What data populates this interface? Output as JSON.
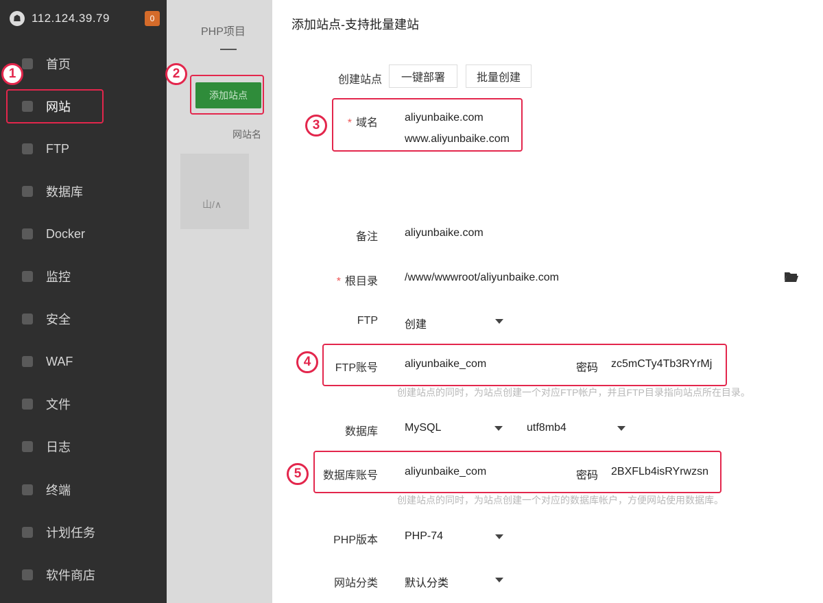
{
  "sidebar": {
    "server_ip": "112.124.39.79",
    "badge": "0",
    "items": [
      {
        "label": "首页",
        "icon": "home-icon"
      },
      {
        "label": "网站",
        "icon": "globe-icon"
      },
      {
        "label": "FTP",
        "icon": "ftp-icon"
      },
      {
        "label": "数据库",
        "icon": "database-icon"
      },
      {
        "label": "Docker",
        "icon": "docker-icon"
      },
      {
        "label": "监控",
        "icon": "monitor-icon"
      },
      {
        "label": "安全",
        "icon": "shield-icon"
      },
      {
        "label": "WAF",
        "icon": "waf-icon"
      },
      {
        "label": "文件",
        "icon": "folder-icon"
      },
      {
        "label": "日志",
        "icon": "log-icon"
      },
      {
        "label": "终端",
        "icon": "terminal-icon"
      },
      {
        "label": "计划任务",
        "icon": "clock-icon"
      },
      {
        "label": "软件商店",
        "icon": "store-icon"
      }
    ],
    "active_item": "网站"
  },
  "middle": {
    "tab_label": "PHP项目",
    "add_site_button": "添加站点",
    "text": "网站名",
    "block_text": "山/∧"
  },
  "dialog": {
    "title": "添加站点-支持批量建站",
    "create_label": "创建站点",
    "one_click_deploy": "一键部署",
    "batch_create": "批量创建",
    "domain_label": "域名",
    "domain_lines": [
      "aliyunbaike.com",
      "www.aliyunbaike.com"
    ],
    "remark_label": "备注",
    "remark_value": "aliyunbaike.com",
    "root_label": "根目录",
    "root_value": "/www/wwwroot/aliyunbaike.com",
    "ftp_label": "FTP",
    "ftp_value": "创建",
    "ftp_account_label": "FTP账号",
    "ftp_account_value": "aliyunbaike_com",
    "ftp_password_label": "密码",
    "ftp_password_value": "zc5mCTy4Tb3RYrMj",
    "ftp_hint": "创建站点的同时，为站点创建一个对应FTP帐户，并且FTP目录指向站点所在目录。",
    "db_label": "数据库",
    "db_value": "MySQL",
    "db_charset": "utf8mb4",
    "db_account_label": "数据库账号",
    "db_account_value": "aliyunbaike_com",
    "db_password_label": "密码",
    "db_password_value": "2BXFLb4isRYrwzsn",
    "db_hint": "创建站点的同时，为站点创建一个对应的数据库帐户，方便网站使用数据库。",
    "php_label": "PHP版本",
    "php_value": "PHP-74",
    "category_label": "网站分类",
    "category_value": "默认分类"
  },
  "annotations": [
    "1",
    "2",
    "3",
    "4",
    "5"
  ],
  "colors": {
    "highlight": "#e3264c",
    "sidebar_bg": "#2f2f2f",
    "green_button": "#2f8c3a"
  }
}
